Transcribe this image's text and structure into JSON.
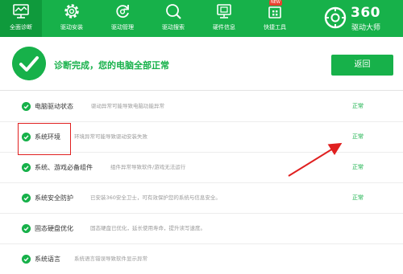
{
  "nav": {
    "tabs": [
      {
        "label": "全面诊断",
        "icon": "monitor-icon",
        "active": true
      },
      {
        "label": "驱动安装",
        "icon": "gear-icon",
        "active": false
      },
      {
        "label": "驱动管理",
        "icon": "refresh-icon",
        "active": false
      },
      {
        "label": "驱动搜索",
        "icon": "search-icon",
        "active": false
      },
      {
        "label": "硬件信息",
        "icon": "display-icon",
        "active": false
      },
      {
        "label": "快捷工具",
        "icon": "toolbox-icon",
        "active": false
      }
    ],
    "badge": "NEW",
    "brand_number": "360",
    "brand_name": "驱动大师"
  },
  "summary": {
    "message": "诊断完成，您的电脑全部正常",
    "back_label": "返回"
  },
  "rows": [
    {
      "name": "电脑驱动状态",
      "desc": "驱动异常可能导致电脑功能异常",
      "status": "正常"
    },
    {
      "name": "系统环境",
      "desc": "环境异常可能导致驱动安装失败",
      "status": "正常"
    },
    {
      "name": "系统、游戏必备组件",
      "desc": "组件异常导致软件/游戏无法运行",
      "status": "正常"
    },
    {
      "name": "系统安全防护",
      "desc": "已安装360安全卫士，可有效保护您的系统与信息安全。",
      "status": "正常"
    },
    {
      "name": "固态硬盘优化",
      "desc": "固态硬盘已优化，延长使用寿命，提升读写速度。",
      "status": ""
    },
    {
      "name": "系统语言",
      "desc": "系统语言错误导致软件显示异常",
      "status": ""
    }
  ],
  "colors": {
    "accent": "#17b14a",
    "highlight": "#e02020"
  }
}
